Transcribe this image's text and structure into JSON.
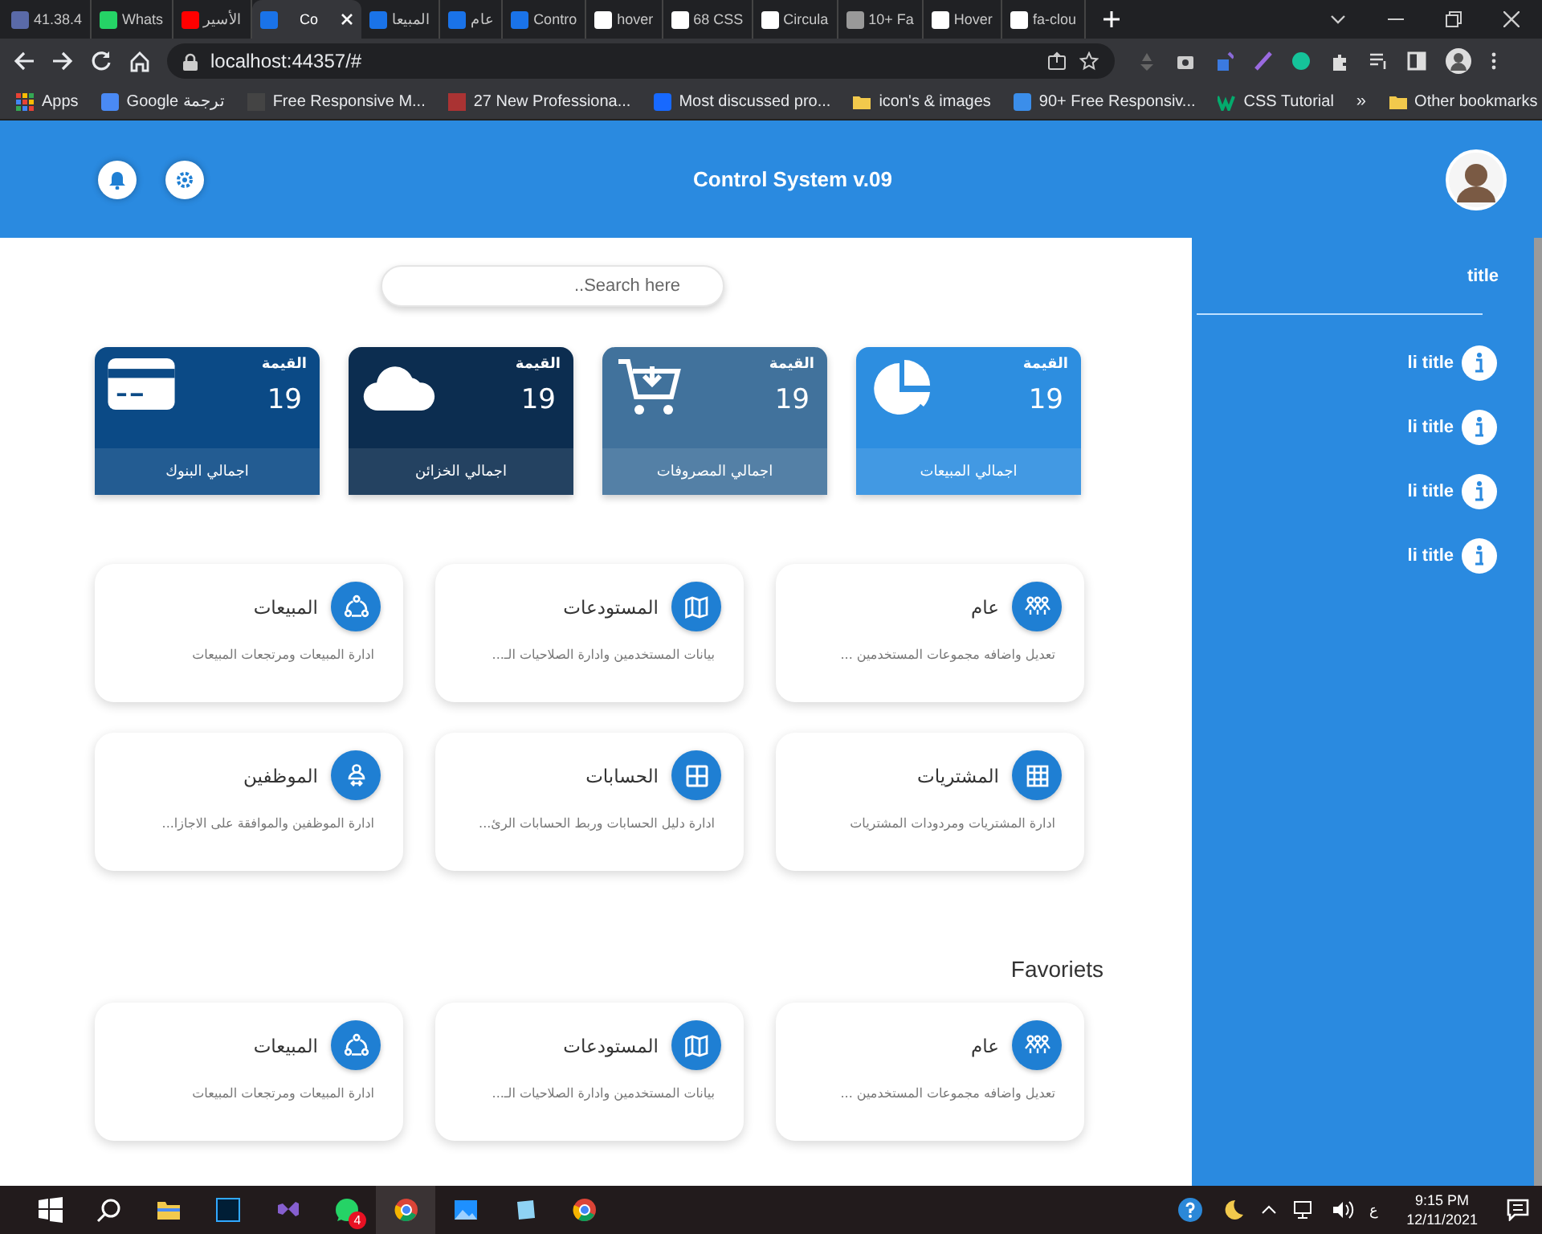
{
  "browser": {
    "tabs": [
      {
        "label": "fa-clou",
        "selected": false
      },
      {
        "label": "Hover",
        "selected": false
      },
      {
        "label": "10+ Fa",
        "selected": false
      },
      {
        "label": "Circula",
        "selected": false
      },
      {
        "label": "68 CSS",
        "selected": false
      },
      {
        "label": "hover",
        "selected": false
      },
      {
        "label": "Contro",
        "selected": false
      },
      {
        "label": "عام",
        "selected": false
      },
      {
        "label": "المبيعا",
        "selected": false
      },
      {
        "label": "Co",
        "selected": true
      },
      {
        "label": "الأسير",
        "selected": false
      },
      {
        "label": "Whats",
        "selected": false
      },
      {
        "label": "41.38.4",
        "selected": false
      }
    ],
    "address": "localhost:44357/#",
    "bookmarks": [
      {
        "label": "CSS Tutorial"
      },
      {
        "label": "90+ Free Responsiv..."
      },
      {
        "label": "icon's & images"
      },
      {
        "label": "Most discussed pro..."
      },
      {
        "label": "27 New Professiona..."
      },
      {
        "label": "Free Responsive M..."
      },
      {
        "label": "Google ترجمة"
      },
      {
        "label": "Apps"
      }
    ],
    "more": "»",
    "other_bookmarks": "Other bookmarks"
  },
  "header": {
    "title": "Control System v.09"
  },
  "search": {
    "placeholder": "Search here.."
  },
  "stats": [
    {
      "value_label": "القيمة",
      "value": "19",
      "caption": "اجمالي المبيعات",
      "color": "#2d8ee0"
    },
    {
      "value_label": "القيمة",
      "value": "19",
      "caption": "اجمالي المصروفات",
      "color": "#41729c"
    },
    {
      "value_label": "القيمة",
      "value": "19",
      "caption": "اجمالي الخزائن",
      "color": "#0c2d50"
    },
    {
      "value_label": "القيمة",
      "value": "19",
      "caption": "اجمالي البنوك",
      "color": "#0b4a86"
    }
  ],
  "modules": [
    {
      "title": "عام",
      "description": "تعديل واضافه مجموعات المستخدمين ..."
    },
    {
      "title": "المستودعات",
      "description": "بيانات المستخدمين وادارة الصلاحيات الـ..."
    },
    {
      "title": "المبيعات",
      "description": "ادارة المبيعات ومرتجعات المبيعات"
    },
    {
      "title": "المشتريات",
      "description": "ادارة المشتريات ومردودات المشتريات"
    },
    {
      "title": "الحسابات",
      "description": "ادارة دليل الحسابات وربط الحسابات الرئ..."
    },
    {
      "title": "الموظفين",
      "description": "ادارة الموظفين والموافقة على الاجازا..."
    }
  ],
  "favorites": {
    "heading": "Favoriets",
    "items": [
      {
        "title": "عام",
        "description": "تعديل واضافه مجموعات المستخدمين ..."
      },
      {
        "title": "المستودعات",
        "description": "بيانات المستخدمين وادارة الصلاحيات الـ..."
      },
      {
        "title": "المبيعات",
        "description": "ادارة المبيعات ومرتجعات المبيعات"
      }
    ]
  },
  "sidebar": {
    "title": "title",
    "items": [
      {
        "label": "li title"
      },
      {
        "label": "li title"
      },
      {
        "label": "li title"
      },
      {
        "label": "li title"
      }
    ]
  },
  "taskbar": {
    "whatsapp_badge": "4",
    "input_language": "ع",
    "time": "9:15 PM",
    "date": "12/11/2021"
  }
}
